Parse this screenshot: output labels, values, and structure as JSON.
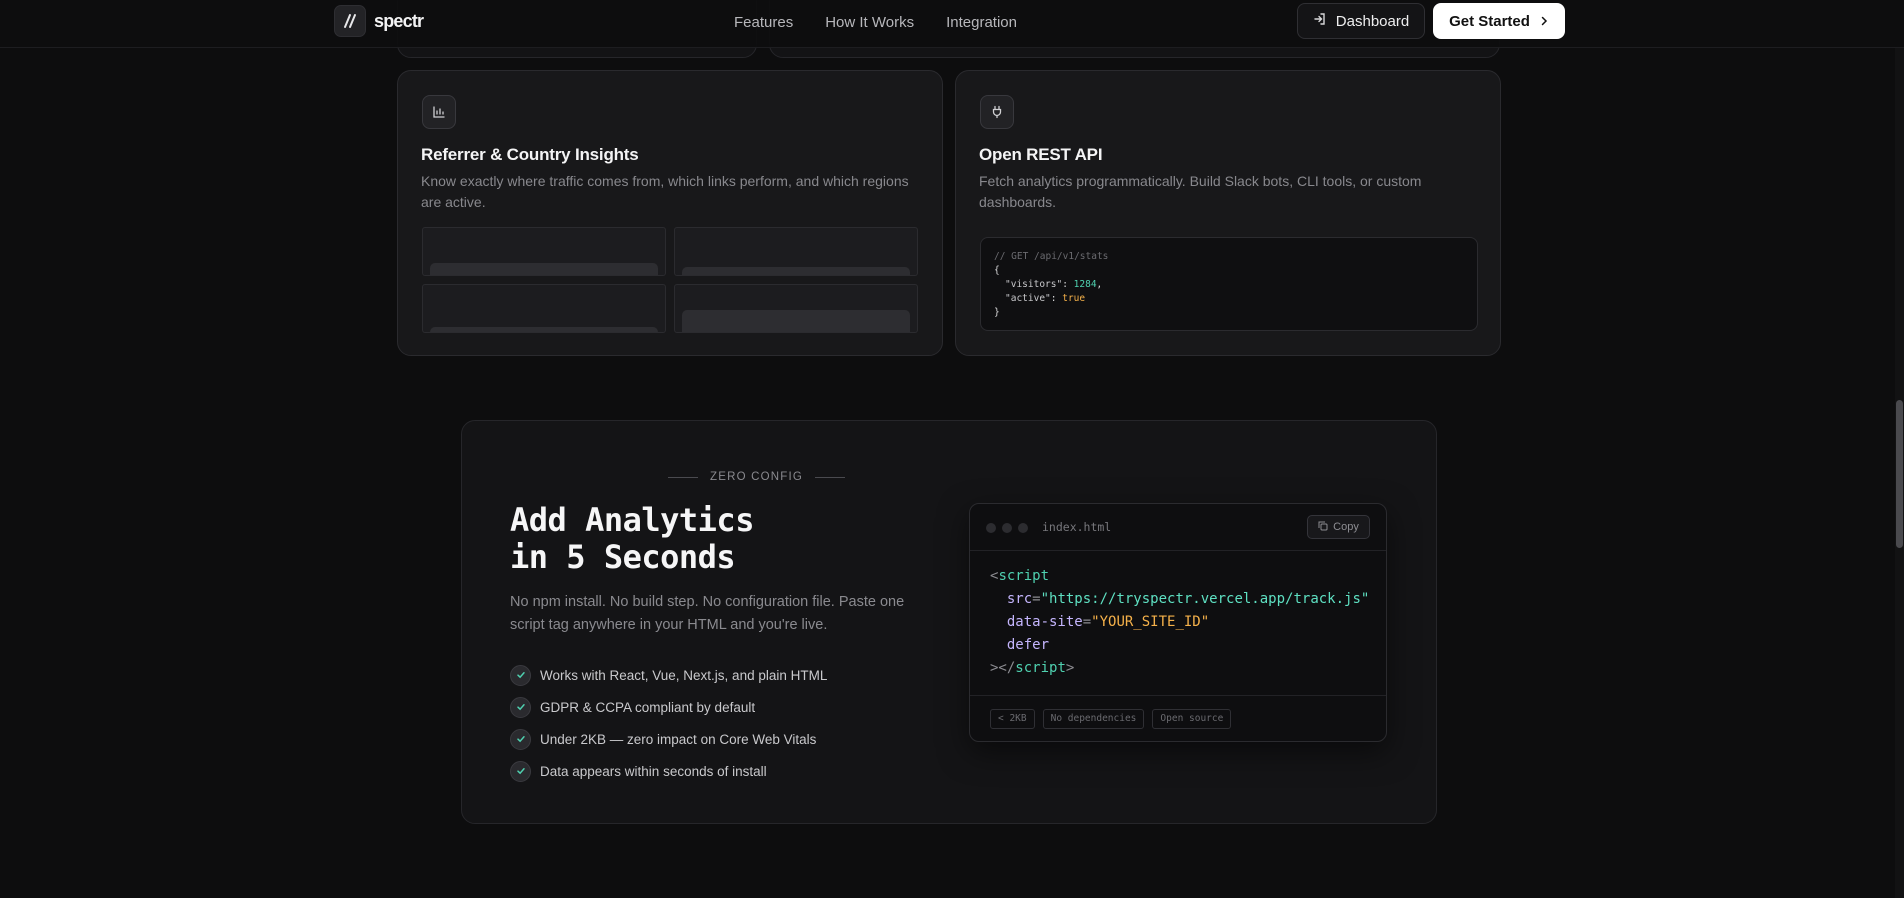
{
  "nav": {
    "brand": "spectr",
    "links": [
      "Features",
      "How It Works",
      "Integration"
    ],
    "dashboard_label": "Dashboard",
    "get_started_label": "Get Started"
  },
  "features": [
    {
      "icon": "bar-chart-icon",
      "title": "Referrer & Country Insights",
      "description": "Know exactly where traffic comes from, which links perform, and which regions are active."
    },
    {
      "icon": "plug-icon",
      "title": "Open REST API",
      "description": "Fetch analytics programmatically. Build Slack bots, CLI tools, or custom dashboards.",
      "code": {
        "comment": "// GET /api/v1/stats",
        "open": "{",
        "visitors_key": "\"visitors\"",
        "visitors_value": "1284",
        "active_key": "\"active\"",
        "active_value": "true",
        "close": "}"
      }
    }
  ],
  "zero_config": {
    "eyebrow": "ZERO CONFIG",
    "title_line1": "Add Analytics",
    "title_line2": "in 5 Seconds",
    "subtitle": "No npm install. No build step. No configuration file. Paste one script tag anywhere in your HTML and you're live.",
    "checks": [
      "Works with React, Vue, Next.js, and plain HTML",
      "GDPR & CCPA compliant by default",
      "Under 2KB — zero impact on Core Web Vitals",
      "Data appears within seconds of install"
    ],
    "editor": {
      "filename": "index.html",
      "copy_label": "Copy",
      "tag": "script",
      "src_attr": "src",
      "src_value": "\"https://tryspectr.vercel.app/track.js\"",
      "site_attr": "data-site",
      "site_value": "\"YOUR_SITE_ID\"",
      "defer_attr": "defer",
      "chips": [
        "< 2KB",
        "No dependencies",
        "Open source"
      ]
    }
  }
}
